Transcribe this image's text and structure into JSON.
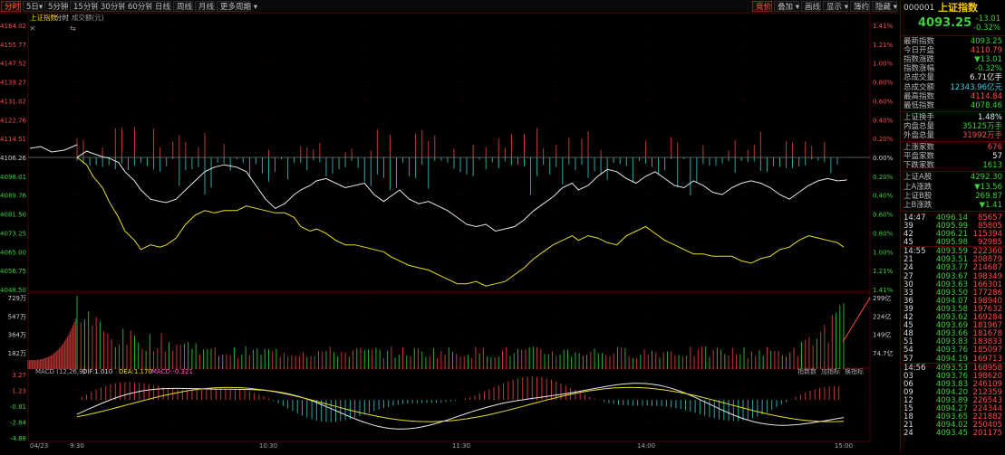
{
  "toolbar": {
    "left": [
      {
        "label": "分时",
        "active": true
      },
      {
        "label": "5日▾",
        "active": false
      },
      {
        "label": "5分钟",
        "active": false
      },
      {
        "label": "15分钟",
        "active": false
      },
      {
        "label": "30分钟",
        "active": false
      },
      {
        "label": "60分钟",
        "active": false
      },
      {
        "label": "日线",
        "active": false
      },
      {
        "label": "周线",
        "active": false
      },
      {
        "label": "月线",
        "active": false
      },
      {
        "label": "更多周期 ▾",
        "active": false
      }
    ],
    "right": [
      {
        "label": "竞价",
        "active": true
      },
      {
        "label": "叠加 ▾",
        "active": false
      },
      {
        "label": "画线",
        "active": false
      },
      {
        "label": "显示 ▾",
        "active": false
      },
      {
        "label": "簿约",
        "active": false
      },
      {
        "label": "隐藏 ▾",
        "active": false
      }
    ]
  },
  "header_labels": {
    "index": "上证指数",
    "mode": "分时",
    "volume": "成交额(元)"
  },
  "close_icon": "×",
  "collapse_icon": "⇆",
  "chart_data": {
    "type": "line",
    "title": "上证指数 分时",
    "prev_close": 4106.26,
    "price_axis": {
      "labels": [
        "4164.02",
        "4155.77",
        "4147.52",
        "4139.27",
        "4131.02",
        "4122.76",
        "4114.51",
        "4106.26",
        "4098.01",
        "4089.76",
        "4081.50",
        "4073.25",
        "4065.00",
        "4056.75",
        "4048.50"
      ]
    },
    "pct_axis": {
      "labels": [
        "1.41%",
        "1.21%",
        "1.00%",
        "0.80%",
        "0.60%",
        "0.40%",
        "0.20%",
        "0.00%",
        "0.20%",
        "0.40%",
        "0.60%",
        "0.80%",
        "1.00%",
        "1.21%",
        "1.41%"
      ]
    },
    "time_labels": [
      "04/23",
      "9:30",
      "10:30",
      "11:30",
      "14:00",
      "15:00"
    ],
    "price_series": [
      {
        "name": "指数",
        "color": "#e8e8e8",
        "points": [
          [
            0,
            4106.3
          ],
          [
            3,
            4109
          ],
          [
            5,
            4108
          ],
          [
            8,
            4106.5
          ],
          [
            10,
            4106
          ],
          [
            13,
            4104
          ],
          [
            15,
            4100
          ],
          [
            18,
            4096
          ],
          [
            20,
            4092
          ],
          [
            23,
            4088
          ],
          [
            26,
            4087
          ],
          [
            28,
            4086.5
          ],
          [
            31,
            4088
          ],
          [
            34,
            4092
          ],
          [
            37,
            4096
          ],
          [
            40,
            4100
          ],
          [
            43,
            4102
          ],
          [
            46,
            4103
          ],
          [
            50,
            4102
          ],
          [
            53,
            4100
          ],
          [
            56,
            4094
          ],
          [
            59,
            4088
          ],
          [
            62,
            4084
          ],
          [
            65,
            4086
          ],
          [
            68,
            4090
          ],
          [
            70,
            4092
          ],
          [
            73,
            4094
          ],
          [
            75,
            4096
          ],
          [
            78,
            4097
          ],
          [
            81,
            4095
          ],
          [
            84,
            4093
          ],
          [
            87,
            4094
          ],
          [
            90,
            4095
          ],
          [
            93,
            4090
          ],
          [
            96,
            4087
          ],
          [
            98,
            4089
          ],
          [
            101,
            4092
          ],
          [
            104,
            4088
          ],
          [
            107,
            4086
          ],
          [
            110,
            4087
          ],
          [
            113,
            4085
          ],
          [
            116,
            4083
          ],
          [
            119,
            4080
          ],
          [
            122,
            4077
          ],
          [
            125,
            4076
          ],
          [
            128,
            4077
          ],
          [
            131,
            4074
          ],
          [
            134,
            4075
          ],
          [
            137,
            4076
          ],
          [
            140,
            4079
          ],
          [
            143,
            4083
          ],
          [
            146,
            4086
          ],
          [
            149,
            4089
          ],
          [
            152,
            4093
          ],
          [
            155,
            4095
          ],
          [
            157,
            4092
          ],
          [
            160,
            4094
          ],
          [
            163,
            4098
          ],
          [
            166,
            4101
          ],
          [
            169,
            4100
          ],
          [
            172,
            4097
          ],
          [
            175,
            4095
          ],
          [
            178,
            4098
          ],
          [
            181,
            4100
          ],
          [
            184,
            4097
          ],
          [
            187,
            4094
          ],
          [
            190,
            4093
          ],
          [
            193,
            4096
          ],
          [
            196,
            4094
          ],
          [
            199,
            4091
          ],
          [
            202,
            4090
          ],
          [
            205,
            4093
          ],
          [
            208,
            4095
          ],
          [
            211,
            4096
          ],
          [
            214,
            4095
          ],
          [
            217,
            4093
          ],
          [
            220,
            4090
          ],
          [
            223,
            4088
          ],
          [
            226,
            4091
          ],
          [
            229,
            4094
          ],
          [
            232,
            4096
          ],
          [
            235,
            4097
          ],
          [
            238,
            4096
          ],
          [
            241,
            4096.5
          ],
          [
            240,
            4096.2
          ]
        ]
      },
      {
        "name": "均价",
        "color": "#e8e020",
        "points": [
          [
            0,
            4106.3
          ],
          [
            3,
            4103
          ],
          [
            5,
            4098
          ],
          [
            8,
            4093
          ],
          [
            10,
            4087
          ],
          [
            13,
            4080
          ],
          [
            15,
            4074
          ],
          [
            18,
            4070
          ],
          [
            20,
            4066
          ],
          [
            23,
            4068
          ],
          [
            26,
            4067
          ],
          [
            28,
            4068
          ],
          [
            31,
            4071
          ],
          [
            34,
            4077
          ],
          [
            37,
            4081
          ],
          [
            40,
            4083
          ],
          [
            43,
            4082
          ],
          [
            46,
            4083
          ],
          [
            50,
            4083
          ],
          [
            53,
            4085
          ],
          [
            56,
            4084
          ],
          [
            59,
            4083
          ],
          [
            62,
            4082
          ],
          [
            65,
            4082
          ],
          [
            68,
            4080
          ],
          [
            70,
            4076
          ],
          [
            73,
            4074
          ],
          [
            75,
            4075
          ],
          [
            78,
            4073
          ],
          [
            81,
            4070
          ],
          [
            84,
            4068
          ],
          [
            87,
            4068
          ],
          [
            90,
            4067
          ],
          [
            93,
            4066
          ],
          [
            96,
            4065
          ],
          [
            98,
            4063
          ],
          [
            101,
            4061
          ],
          [
            104,
            4059
          ],
          [
            107,
            4058
          ],
          [
            110,
            4057
          ],
          [
            113,
            4055
          ],
          [
            116,
            4053
          ],
          [
            119,
            4051
          ],
          [
            122,
            4051
          ],
          [
            125,
            4052
          ],
          [
            128,
            4050
          ],
          [
            131,
            4051
          ],
          [
            134,
            4052
          ],
          [
            137,
            4055
          ],
          [
            140,
            4058
          ],
          [
            143,
            4062
          ],
          [
            146,
            4065
          ],
          [
            149,
            4068
          ],
          [
            152,
            4070
          ],
          [
            155,
            4072
          ],
          [
            157,
            4070
          ],
          [
            160,
            4072
          ],
          [
            163,
            4071
          ],
          [
            166,
            4069
          ],
          [
            169,
            4068
          ],
          [
            172,
            4072
          ],
          [
            175,
            4074
          ],
          [
            178,
            4076
          ],
          [
            181,
            4073
          ],
          [
            184,
            4070
          ],
          [
            187,
            4068
          ],
          [
            190,
            4066
          ],
          [
            193,
            4064
          ],
          [
            196,
            4064
          ],
          [
            199,
            4063
          ],
          [
            202,
            4063
          ],
          [
            205,
            4063
          ],
          [
            208,
            4061
          ],
          [
            211,
            4060
          ],
          [
            214,
            4062
          ],
          [
            217,
            4063
          ],
          [
            220,
            4066
          ],
          [
            223,
            4067
          ],
          [
            226,
            4070
          ],
          [
            229,
            4072
          ],
          [
            232,
            4071
          ],
          [
            235,
            4070
          ],
          [
            238,
            4069
          ],
          [
            240,
            4067
          ]
        ]
      }
    ],
    "volume_axis": {
      "labels": [
        "729万",
        "547万",
        "364万",
        "182万"
      ],
      "right_labels": [
        "299亿",
        "224亿",
        "149亿",
        "74.7亿"
      ]
    },
    "macd": {
      "label": "MACD",
      "params": "(12,26,9)",
      "dif_label": "DIF:1.010",
      "dea_label": "DEA:1.170",
      "macd_label": "MACD:-0.321",
      "dif": 1.01,
      "dea": 1.17,
      "macd": -0.321,
      "axis_labels": [
        "3.27",
        "1.23",
        "-0.81",
        "-2.84",
        "-4.88"
      ],
      "tools": [
        "指数数",
        "加指标",
        "换指标"
      ]
    }
  },
  "side": {
    "code": "000001",
    "name": "上证指数",
    "price": "4093.25",
    "change": "-13.01",
    "change_pct": "-0.32%",
    "stats": [
      {
        "label": "最新指数",
        "value": "4093.25",
        "cls": "green"
      },
      {
        "label": "今日开盘",
        "value": "4110.79",
        "cls": "red"
      },
      {
        "label": "指数涨跌",
        "value": "▼13.01",
        "cls": "green"
      },
      {
        "label": "指数涨幅",
        "value": "-0.32%",
        "cls": "green"
      },
      {
        "label": "总成交量",
        "value": "6.71亿手",
        "cls": "white"
      },
      {
        "label": "总成交额",
        "value": "12343.96亿元",
        "cls": "cyan"
      },
      {
        "label": "最高指数",
        "value": "4114.84",
        "cls": "red"
      },
      {
        "label": "最低指数",
        "value": "4078.46",
        "cls": "green"
      }
    ],
    "stats2": [
      {
        "label": "上证换手",
        "value": "1.48%",
        "cls": "white"
      },
      {
        "label": "内盘总量",
        "value": "35125万手",
        "cls": "green"
      },
      {
        "label": "外盘总量",
        "value": "31992万手",
        "cls": "red"
      }
    ],
    "stats3": [
      {
        "label": "上涨家数",
        "value": "676",
        "cls": "red"
      },
      {
        "label": "平盘家数",
        "value": "57",
        "cls": "white"
      },
      {
        "label": "下跌家数",
        "value": "1613",
        "cls": "green"
      }
    ],
    "stats4": [
      {
        "label": "上证A股",
        "value": "4292.30",
        "cls": "green"
      },
      {
        "label": "上A涨跌",
        "value": "▼13.56",
        "cls": "green"
      },
      {
        "label": "上证B股",
        "value": "269.87",
        "cls": "green"
      },
      {
        "label": "上B涨跌",
        "value": "▼1.41",
        "cls": "green"
      }
    ],
    "ticks": [
      {
        "t": "14:47",
        "p": "4096.14",
        "v": "85657",
        "pc": "green",
        "vc": "red"
      },
      {
        "t": "39",
        "p": "4095.99",
        "v": "85805",
        "pc": "green",
        "vc": "red"
      },
      {
        "t": "42",
        "p": "4096.21",
        "v": "115394",
        "pc": "green",
        "vc": "red"
      },
      {
        "t": "45",
        "p": "4095.98",
        "v": "92985",
        "pc": "green",
        "vc": "red"
      },
      {
        "t": "14:55",
        "p": "4093.59",
        "v": "222360",
        "pc": "green",
        "vc": "red"
      },
      {
        "t": "21",
        "p": "4093.51",
        "v": "208879",
        "pc": "green",
        "vc": "red"
      },
      {
        "t": "24",
        "p": "4093.77",
        "v": "214687",
        "pc": "green",
        "vc": "red"
      },
      {
        "t": "27",
        "p": "4093.67",
        "v": "198349",
        "pc": "green",
        "vc": "red"
      },
      {
        "t": "30",
        "p": "4093.63",
        "v": "166301",
        "pc": "green",
        "vc": "red"
      },
      {
        "t": "33",
        "p": "4093.50",
        "v": "177286",
        "pc": "green",
        "vc": "red"
      },
      {
        "t": "36",
        "p": "4094.07",
        "v": "198940",
        "pc": "green",
        "vc": "red"
      },
      {
        "t": "39",
        "p": "4093.58",
        "v": "197632",
        "pc": "green",
        "vc": "red"
      },
      {
        "t": "42",
        "p": "4093.62",
        "v": "169284",
        "pc": "green",
        "vc": "red"
      },
      {
        "t": "45",
        "p": "4093.69",
        "v": "181967",
        "pc": "green",
        "vc": "red"
      },
      {
        "t": "48",
        "p": "4093.66",
        "v": "181678",
        "pc": "green",
        "vc": "red"
      },
      {
        "t": "51",
        "p": "4093.83",
        "v": "183833",
        "pc": "green",
        "vc": "red"
      },
      {
        "t": "54",
        "p": "4093.76",
        "v": "185097",
        "pc": "green",
        "vc": "red"
      },
      {
        "t": "57",
        "p": "4094.19",
        "v": "169713",
        "pc": "green",
        "vc": "red"
      },
      {
        "t": "14:56",
        "p": "4093.53",
        "v": "168958",
        "pc": "green",
        "vc": "red"
      },
      {
        "t": "03",
        "p": "4093.76",
        "v": "198620",
        "pc": "green",
        "vc": "red"
      },
      {
        "t": "06",
        "p": "4093.83",
        "v": "246109",
        "pc": "green",
        "vc": "red"
      },
      {
        "t": "09",
        "p": "4094.20",
        "v": "212359",
        "pc": "green",
        "vc": "red"
      },
      {
        "t": "12",
        "p": "4093.89",
        "v": "226543",
        "pc": "green",
        "vc": "red"
      },
      {
        "t": "15",
        "p": "4094.27",
        "v": "224344",
        "pc": "green",
        "vc": "red"
      },
      {
        "t": "18",
        "p": "4093.65",
        "v": "221882",
        "pc": "green",
        "vc": "red"
      },
      {
        "t": "21",
        "p": "4094.02",
        "v": "250405",
        "pc": "green",
        "vc": "red"
      },
      {
        "t": "24",
        "p": "4093.45",
        "v": "201175",
        "pc": "green",
        "vc": "red"
      }
    ]
  }
}
